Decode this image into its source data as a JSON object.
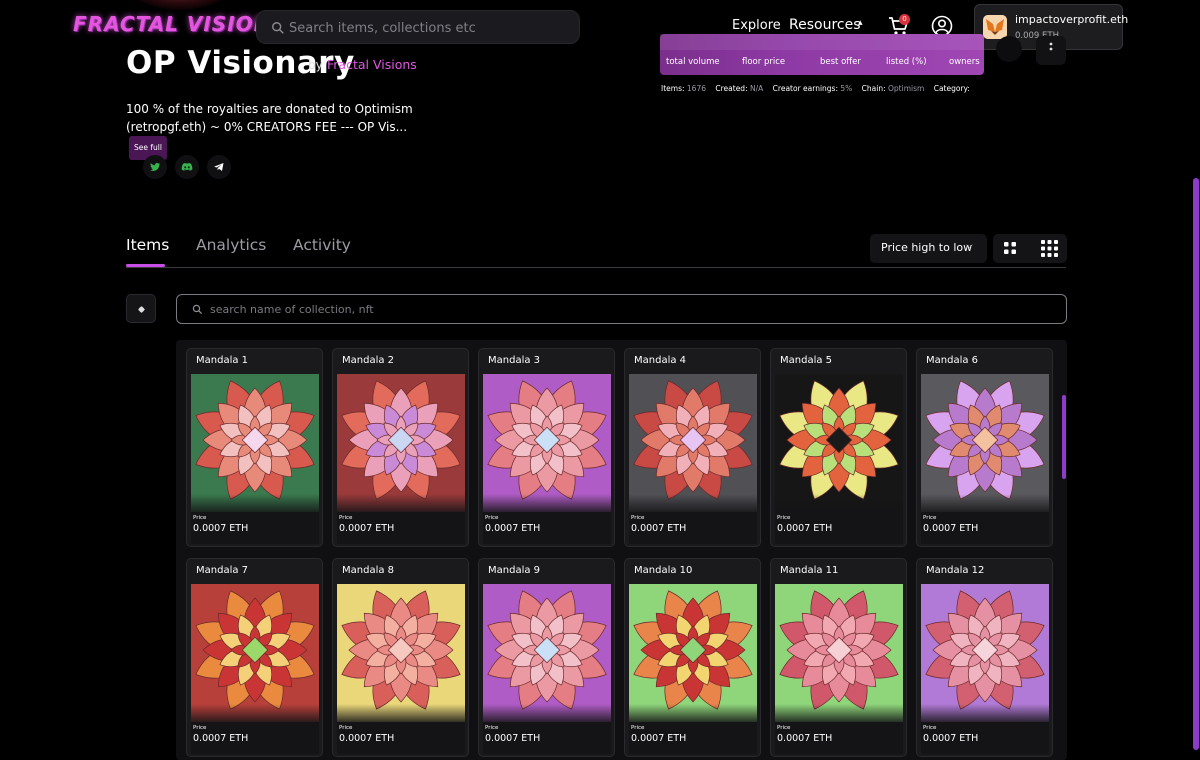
{
  "brand": {
    "logo_text": "FRACTAL VISIONS"
  },
  "search": {
    "placeholder": "Search items, collections etc"
  },
  "nav": {
    "explore": "Explore",
    "resources": "Resources"
  },
  "cart": {
    "count": "0"
  },
  "wallet": {
    "name": "impactoverprofit.eth",
    "balance": "0.009 ETH"
  },
  "collection": {
    "title": "OP Visionary",
    "by_label": "by",
    "creator": "Fractal Visions",
    "description": "100 % of the royalties are donated to Optimism (retropgf.eth) ~ 0% CREATORS FEE --- OP Vis...",
    "see_full": "See full"
  },
  "stats": {
    "labels": [
      "total volume",
      "floor price",
      "best offer",
      "listed (%)",
      "owners"
    ]
  },
  "meta": {
    "items_label": "Items:",
    "items_value": "1676",
    "created_label": "Created:",
    "created_value": "N/A",
    "earnings_label": "Creator earnings:",
    "earnings_value": "5%",
    "chain_label": "Chain:",
    "chain_value": "Optimism",
    "category_label": "Category:"
  },
  "tabs": [
    "Items",
    "Analytics",
    "Activity"
  ],
  "sort": {
    "selected": "Price high to low"
  },
  "item_search": {
    "placeholder": "search name of collection, nft"
  },
  "price_label": "Price",
  "items": [
    {
      "name": "Mandala 1",
      "price": "0.0007 ETH",
      "bg": "#3a7a4e",
      "outer": "#d85a4f",
      "mid": "#e88a7a",
      "inner": "#f3c0c0",
      "core": "#f6d8ee"
    },
    {
      "name": "Mandala 2",
      "price": "0.0007 ETH",
      "bg": "#9b3a3a",
      "outer": "#e36b5b",
      "mid": "#e9a0b8",
      "inner": "#c98ad8",
      "core": "#c9d6f4"
    },
    {
      "name": "Mandala 3",
      "price": "0.0007 ETH",
      "bg": "#b05cc6",
      "outer": "#e47e84",
      "mid": "#eb9aa4",
      "inner": "#f2c0c8",
      "core": "#c9e0f6"
    },
    {
      "name": "Mandala 4",
      "price": "0.0007 ETH",
      "bg": "#505055",
      "outer": "#c94a44",
      "mid": "#e27a6a",
      "inner": "#f1b0b8",
      "core": "#e6c5f2"
    },
    {
      "name": "Mandala 5",
      "price": "0.0007 ETH",
      "bg": "#161616",
      "outer": "#e9e884",
      "mid": "#e2633d",
      "inner": "#b8e07a",
      "core": "#1a1a1a"
    },
    {
      "name": "Mandala 6",
      "price": "0.0007 ETH",
      "bg": "#5a5a5e",
      "outer": "#d9a4ef",
      "mid": "#b87acc",
      "inner": "#e08a70",
      "core": "#f3c0a0"
    },
    {
      "name": "Mandala 7",
      "price": "0.0007 ETH",
      "bg": "#b8403a",
      "outer": "#ea8a3e",
      "mid": "#c93434",
      "inner": "#f4d078",
      "core": "#9ad86a"
    },
    {
      "name": "Mandala 8",
      "price": "0.0007 ETH",
      "bg": "#e9d77a",
      "outer": "#d9605a",
      "mid": "#e98a84",
      "inner": "#f3b0a0",
      "core": "#f6c9c0"
    },
    {
      "name": "Mandala 9",
      "price": "0.0007 ETH",
      "bg": "#b05cc6",
      "outer": "#e47e84",
      "mid": "#eb9aa4",
      "inner": "#f2c0c8",
      "core": "#c9e0f6"
    },
    {
      "name": "Mandala 10",
      "price": "0.0007 ETH",
      "bg": "#8fd67a",
      "outer": "#e9844a",
      "mid": "#c93434",
      "inner": "#f2d470",
      "core": "#8fd67a"
    },
    {
      "name": "Mandala 11",
      "price": "0.0007 ETH",
      "bg": "#8fd67a",
      "outer": "#d0586a",
      "mid": "#e78a9a",
      "inner": "#f2a8b0",
      "core": "#f6d0d4"
    },
    {
      "name": "Mandala 12",
      "price": "0.0007 ETH",
      "bg": "#b07ad6",
      "outer": "#d26070",
      "mid": "#e690a4",
      "inner": "#f0b4c0",
      "core": "#f6d4dc"
    }
  ],
  "colors": {
    "accent": "#c94ee6",
    "page_bg": "#000000"
  }
}
